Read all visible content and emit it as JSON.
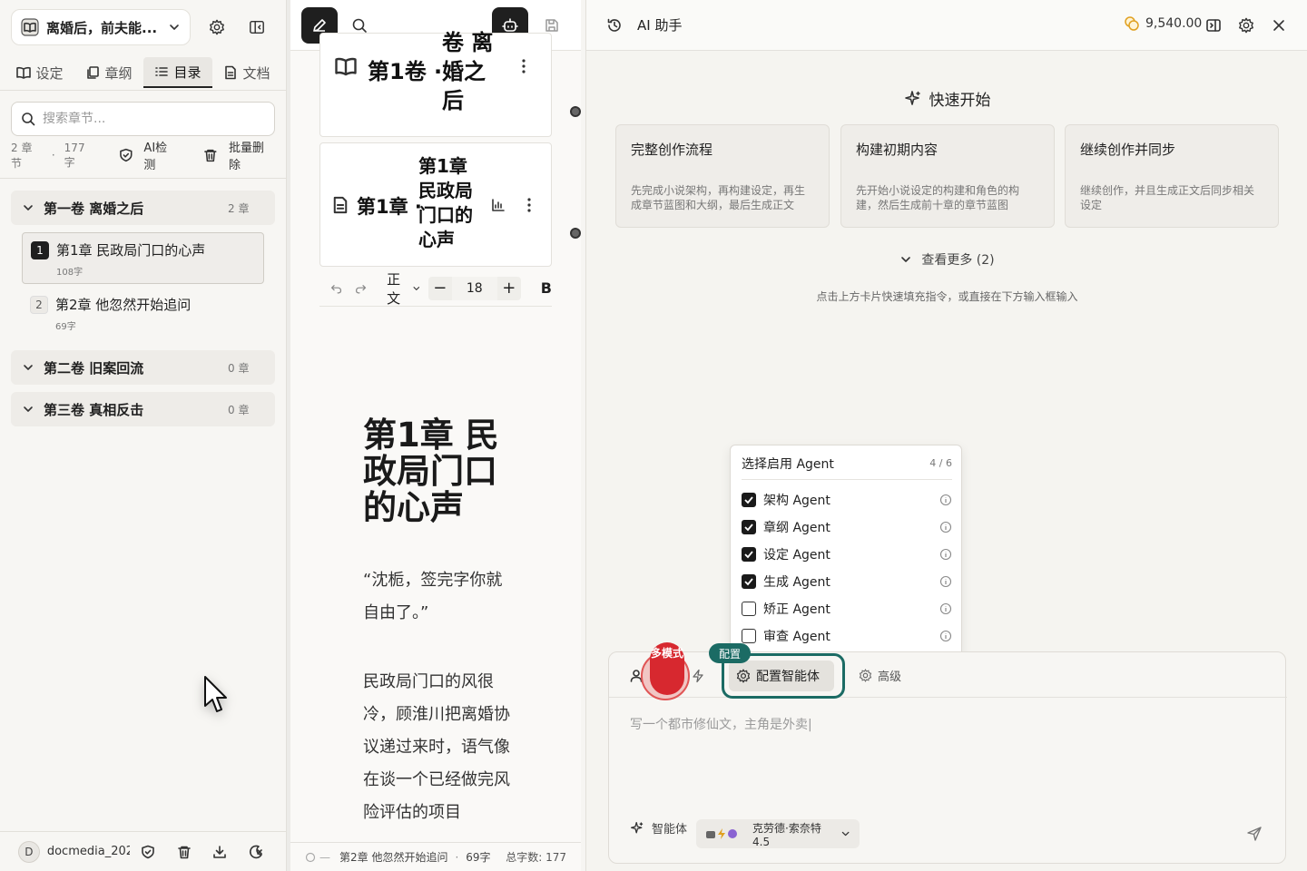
{
  "sidebar": {
    "book_title": "离婚后，前夫能...",
    "tabs": [
      {
        "label": "设定"
      },
      {
        "label": "章纲"
      },
      {
        "label": "目录"
      },
      {
        "label": "文档"
      }
    ],
    "search_placeholder": "搜索章节...",
    "stats": {
      "chapters": "2 章节",
      "dot": "·",
      "words": "177 字",
      "ai_check": "AI检测",
      "batch_delete": "批量删除"
    },
    "volumes": [
      {
        "name": "第一卷 离婚之后",
        "count": "2 章"
      },
      {
        "name": "第二卷 旧案回流",
        "count": "0 章"
      },
      {
        "name": "第三卷 真相反击",
        "count": "0 章"
      }
    ],
    "chapters": [
      {
        "num": "1",
        "title": "第1章 民政局门口的心声",
        "words": "108字"
      },
      {
        "num": "2",
        "title": "第2章 他忽然开始追问",
        "words": "69字"
      }
    ],
    "footer": {
      "avatar": "D",
      "user": "docmedia_202..."
    }
  },
  "editor": {
    "volume_card": {
      "title": "第1卷 ·",
      "subtitle_lines": [
        "卷 离",
        "婚之",
        "后"
      ]
    },
    "chapter_card": {
      "title": "第1章 ·",
      "subtitle_lines": [
        "第1章",
        "民政局",
        "门口的",
        "心声"
      ]
    },
    "toolbar": {
      "style": "正文",
      "font_size": "18",
      "bold": "B"
    },
    "doc_title": "第1章 民政局门口的心声",
    "paragraphs": [
      "“沈栀，签完字你就自由了。”",
      "民政局门口的风很冷，顾淮川把离婚协议递过来时，语气像在谈一个已经做完风险评估的项目"
    ],
    "status": {
      "dash": "—",
      "chapter": "第2章 他忽然开始追问",
      "dot": "·",
      "words": "69字",
      "total": "总字数: 177"
    }
  },
  "ai": {
    "title": "AI 助手",
    "coins": "9,540.00",
    "quick_start": "快速开始",
    "cards": [
      {
        "title": "完整创作流程",
        "desc": "先完成小说架构，再构建设定，再生成章节蓝图和大纲，最后生成正文"
      },
      {
        "title": "构建初期内容",
        "desc": "先开始小说设定的构建和角色的构建，然后生成前十章的章节蓝图"
      },
      {
        "title": "继续创作并同步",
        "desc": "继续创作，并且生成正文后同步相关设定"
      }
    ],
    "see_more": "查看更多 (2)",
    "hint": "点击上方卡片快速填充指令，或直接在下方输入框输入",
    "popup": {
      "title": "选择启用 Agent",
      "count": "4 / 6",
      "agents": [
        {
          "label": "架构 Agent",
          "checked": true
        },
        {
          "label": "章纲 Agent",
          "checked": true
        },
        {
          "label": "设定 Agent",
          "checked": true
        },
        {
          "label": "生成 Agent",
          "checked": true
        },
        {
          "label": "矫正 Agent",
          "checked": false
        },
        {
          "label": "审查 Agent",
          "checked": false
        }
      ]
    },
    "multimode_badge": "多模式",
    "config_badge": "配置",
    "config_button": "配置智能体",
    "advanced": "高级",
    "prompt_placeholder": "写一个都市修仙文，主角是外卖|",
    "agent_label": "智能体",
    "model": "克劳德·索奈特4.5",
    "colors": {
      "accent": "#1b6b64",
      "badge_red": "#d7282f",
      "dark": "#1f1f1f",
      "coin": "#e0a020"
    }
  }
}
